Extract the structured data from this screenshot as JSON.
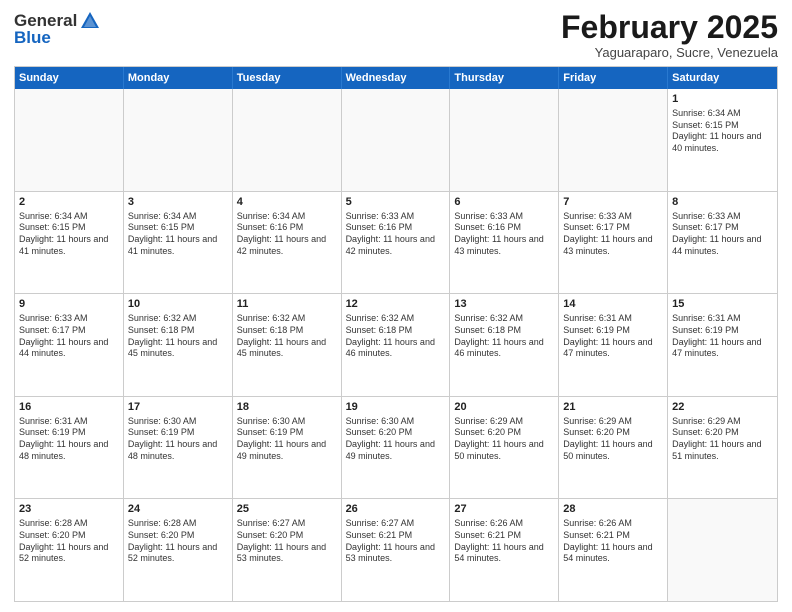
{
  "header": {
    "logo_general": "General",
    "logo_blue": "Blue",
    "month_title": "February 2025",
    "location": "Yaguaraparo, Sucre, Venezuela"
  },
  "days_of_week": [
    "Sunday",
    "Monday",
    "Tuesday",
    "Wednesday",
    "Thursday",
    "Friday",
    "Saturday"
  ],
  "weeks": [
    [
      {
        "day": "",
        "info": ""
      },
      {
        "day": "",
        "info": ""
      },
      {
        "day": "",
        "info": ""
      },
      {
        "day": "",
        "info": ""
      },
      {
        "day": "",
        "info": ""
      },
      {
        "day": "",
        "info": ""
      },
      {
        "day": "1",
        "info": "Sunrise: 6:34 AM\nSunset: 6:15 PM\nDaylight: 11 hours and 40 minutes."
      }
    ],
    [
      {
        "day": "2",
        "info": "Sunrise: 6:34 AM\nSunset: 6:15 PM\nDaylight: 11 hours and 41 minutes."
      },
      {
        "day": "3",
        "info": "Sunrise: 6:34 AM\nSunset: 6:15 PM\nDaylight: 11 hours and 41 minutes."
      },
      {
        "day": "4",
        "info": "Sunrise: 6:34 AM\nSunset: 6:16 PM\nDaylight: 11 hours and 42 minutes."
      },
      {
        "day": "5",
        "info": "Sunrise: 6:33 AM\nSunset: 6:16 PM\nDaylight: 11 hours and 42 minutes."
      },
      {
        "day": "6",
        "info": "Sunrise: 6:33 AM\nSunset: 6:16 PM\nDaylight: 11 hours and 43 minutes."
      },
      {
        "day": "7",
        "info": "Sunrise: 6:33 AM\nSunset: 6:17 PM\nDaylight: 11 hours and 43 minutes."
      },
      {
        "day": "8",
        "info": "Sunrise: 6:33 AM\nSunset: 6:17 PM\nDaylight: 11 hours and 44 minutes."
      }
    ],
    [
      {
        "day": "9",
        "info": "Sunrise: 6:33 AM\nSunset: 6:17 PM\nDaylight: 11 hours and 44 minutes."
      },
      {
        "day": "10",
        "info": "Sunrise: 6:32 AM\nSunset: 6:18 PM\nDaylight: 11 hours and 45 minutes."
      },
      {
        "day": "11",
        "info": "Sunrise: 6:32 AM\nSunset: 6:18 PM\nDaylight: 11 hours and 45 minutes."
      },
      {
        "day": "12",
        "info": "Sunrise: 6:32 AM\nSunset: 6:18 PM\nDaylight: 11 hours and 46 minutes."
      },
      {
        "day": "13",
        "info": "Sunrise: 6:32 AM\nSunset: 6:18 PM\nDaylight: 11 hours and 46 minutes."
      },
      {
        "day": "14",
        "info": "Sunrise: 6:31 AM\nSunset: 6:19 PM\nDaylight: 11 hours and 47 minutes."
      },
      {
        "day": "15",
        "info": "Sunrise: 6:31 AM\nSunset: 6:19 PM\nDaylight: 11 hours and 47 minutes."
      }
    ],
    [
      {
        "day": "16",
        "info": "Sunrise: 6:31 AM\nSunset: 6:19 PM\nDaylight: 11 hours and 48 minutes."
      },
      {
        "day": "17",
        "info": "Sunrise: 6:30 AM\nSunset: 6:19 PM\nDaylight: 11 hours and 48 minutes."
      },
      {
        "day": "18",
        "info": "Sunrise: 6:30 AM\nSunset: 6:19 PM\nDaylight: 11 hours and 49 minutes."
      },
      {
        "day": "19",
        "info": "Sunrise: 6:30 AM\nSunset: 6:20 PM\nDaylight: 11 hours and 49 minutes."
      },
      {
        "day": "20",
        "info": "Sunrise: 6:29 AM\nSunset: 6:20 PM\nDaylight: 11 hours and 50 minutes."
      },
      {
        "day": "21",
        "info": "Sunrise: 6:29 AM\nSunset: 6:20 PM\nDaylight: 11 hours and 50 minutes."
      },
      {
        "day": "22",
        "info": "Sunrise: 6:29 AM\nSunset: 6:20 PM\nDaylight: 11 hours and 51 minutes."
      }
    ],
    [
      {
        "day": "23",
        "info": "Sunrise: 6:28 AM\nSunset: 6:20 PM\nDaylight: 11 hours and 52 minutes."
      },
      {
        "day": "24",
        "info": "Sunrise: 6:28 AM\nSunset: 6:20 PM\nDaylight: 11 hours and 52 minutes."
      },
      {
        "day": "25",
        "info": "Sunrise: 6:27 AM\nSunset: 6:20 PM\nDaylight: 11 hours and 53 minutes."
      },
      {
        "day": "26",
        "info": "Sunrise: 6:27 AM\nSunset: 6:21 PM\nDaylight: 11 hours and 53 minutes."
      },
      {
        "day": "27",
        "info": "Sunrise: 6:26 AM\nSunset: 6:21 PM\nDaylight: 11 hours and 54 minutes."
      },
      {
        "day": "28",
        "info": "Sunrise: 6:26 AM\nSunset: 6:21 PM\nDaylight: 11 hours and 54 minutes."
      },
      {
        "day": "",
        "info": ""
      }
    ]
  ]
}
